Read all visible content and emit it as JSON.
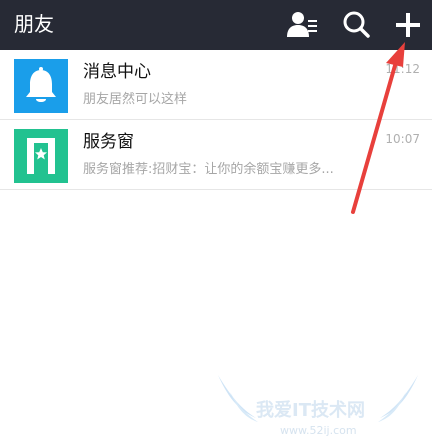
{
  "header": {
    "title": "朋友",
    "background": "#272a35",
    "icons": [
      "contacts-icon",
      "search-icon",
      "plus-icon"
    ]
  },
  "list": [
    {
      "icon": "bell-icon",
      "icon_color": "#1a9eea",
      "title": "消息中心",
      "subtitle": "朋友居然可以这样",
      "time": "11:12"
    },
    {
      "icon": "bookmark-star-icon",
      "icon_color": "#22c290",
      "title": "服务窗",
      "subtitle": "服务窗推荐:招财宝：让你的余额宝赚更多...",
      "time": "10:07"
    }
  ],
  "annotation": {
    "arrow_color": "#e8403c"
  },
  "watermark": {
    "brand": "我爱IT技术网",
    "url": "www.52ij.com"
  }
}
